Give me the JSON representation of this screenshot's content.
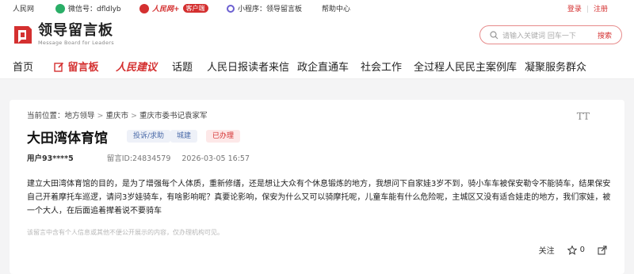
{
  "topbar": {
    "people_net": "人民网",
    "wechat": "微信号：dfldlyb",
    "app_brand": "人民网+",
    "app_badge": "客户端",
    "miniprogram": "小程序：领导留言板",
    "help": "帮助中心",
    "login": "登录",
    "register": "注册",
    "colors": {
      "wechat": "#2aae67",
      "app": "#d43030",
      "mini": "#6b5fd1"
    }
  },
  "header": {
    "logo_title": "领导留言板",
    "logo_subtitle": "Message Board for Leaders",
    "search_placeholder": "请输入关键词 回车一下",
    "search_button": "搜索"
  },
  "nav": [
    {
      "label": "首页",
      "active": false
    },
    {
      "label": "留言板",
      "active": true
    },
    {
      "label": "人民建议",
      "active": false
    },
    {
      "label": "话题",
      "active": false
    },
    {
      "label": "人民日报读者来信",
      "active": false
    },
    {
      "label": "政企直通车",
      "active": false
    },
    {
      "label": "社会工作",
      "active": false
    },
    {
      "label": "全过程人民民主案例库",
      "active": false
    },
    {
      "label": "凝聚服务群众",
      "active": false
    }
  ],
  "post": {
    "breadcrumb_prefix": "当前位置：",
    "breadcrumb": [
      "地方领导",
      "重庆市",
      "重庆市委书记袁家军"
    ],
    "title": "大田湾体育馆",
    "tags": [
      "投诉/求助",
      "城建",
      "已办理"
    ],
    "user": "用户93****5",
    "message_id": "留言ID:24834579",
    "time": "2026-03-05 16:57",
    "content": "建立大田湾体育馆的目的，是为了增强每个人体质，重新修缮，还是想让大众有个休息锻炼的地方，我想问下自家娃3岁不到，骑小车车被保安勒令不能骑车，结果保安自己开着摩托车巡逻，请问3岁娃骑车，有啥影响呢？真要论影响，保安为什么又可以骑摩托呢，儿童车能有什么危险呢，主城区又没有适合娃走的地方，我们家娃，被一个大人，在后面追着撵着说不要骑车",
    "privacy_note": "该留言中含有个人信息或其他不便公开展示的内容，仅办理机构可见。",
    "follow": "关注",
    "likes": "0",
    "font_icon": "TT"
  }
}
